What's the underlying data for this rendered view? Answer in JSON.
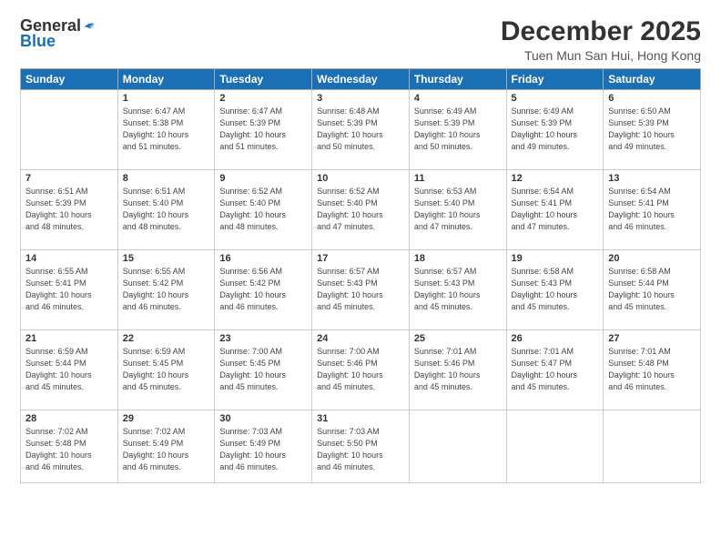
{
  "logo": {
    "general": "General",
    "blue": "Blue"
  },
  "title": "December 2025",
  "location": "Tuen Mun San Hui, Hong Kong",
  "days_header": [
    "Sunday",
    "Monday",
    "Tuesday",
    "Wednesday",
    "Thursday",
    "Friday",
    "Saturday"
  ],
  "weeks": [
    [
      {
        "day": "",
        "sunrise": "",
        "sunset": "",
        "daylight": ""
      },
      {
        "day": "1",
        "sunrise": "Sunrise: 6:47 AM",
        "sunset": "Sunset: 5:38 PM",
        "daylight": "Daylight: 10 hours and 51 minutes."
      },
      {
        "day": "2",
        "sunrise": "Sunrise: 6:47 AM",
        "sunset": "Sunset: 5:39 PM",
        "daylight": "Daylight: 10 hours and 51 minutes."
      },
      {
        "day": "3",
        "sunrise": "Sunrise: 6:48 AM",
        "sunset": "Sunset: 5:39 PM",
        "daylight": "Daylight: 10 hours and 50 minutes."
      },
      {
        "day": "4",
        "sunrise": "Sunrise: 6:49 AM",
        "sunset": "Sunset: 5:39 PM",
        "daylight": "Daylight: 10 hours and 50 minutes."
      },
      {
        "day": "5",
        "sunrise": "Sunrise: 6:49 AM",
        "sunset": "Sunset: 5:39 PM",
        "daylight": "Daylight: 10 hours and 49 minutes."
      },
      {
        "day": "6",
        "sunrise": "Sunrise: 6:50 AM",
        "sunset": "Sunset: 5:39 PM",
        "daylight": "Daylight: 10 hours and 49 minutes."
      }
    ],
    [
      {
        "day": "7",
        "sunrise": "Sunrise: 6:51 AM",
        "sunset": "Sunset: 5:39 PM",
        "daylight": "Daylight: 10 hours and 48 minutes."
      },
      {
        "day": "8",
        "sunrise": "Sunrise: 6:51 AM",
        "sunset": "Sunset: 5:40 PM",
        "daylight": "Daylight: 10 hours and 48 minutes."
      },
      {
        "day": "9",
        "sunrise": "Sunrise: 6:52 AM",
        "sunset": "Sunset: 5:40 PM",
        "daylight": "Daylight: 10 hours and 48 minutes."
      },
      {
        "day": "10",
        "sunrise": "Sunrise: 6:52 AM",
        "sunset": "Sunset: 5:40 PM",
        "daylight": "Daylight: 10 hours and 47 minutes."
      },
      {
        "day": "11",
        "sunrise": "Sunrise: 6:53 AM",
        "sunset": "Sunset: 5:40 PM",
        "daylight": "Daylight: 10 hours and 47 minutes."
      },
      {
        "day": "12",
        "sunrise": "Sunrise: 6:54 AM",
        "sunset": "Sunset: 5:41 PM",
        "daylight": "Daylight: 10 hours and 47 minutes."
      },
      {
        "day": "13",
        "sunrise": "Sunrise: 6:54 AM",
        "sunset": "Sunset: 5:41 PM",
        "daylight": "Daylight: 10 hours and 46 minutes."
      }
    ],
    [
      {
        "day": "14",
        "sunrise": "Sunrise: 6:55 AM",
        "sunset": "Sunset: 5:41 PM",
        "daylight": "Daylight: 10 hours and 46 minutes."
      },
      {
        "day": "15",
        "sunrise": "Sunrise: 6:55 AM",
        "sunset": "Sunset: 5:42 PM",
        "daylight": "Daylight: 10 hours and 46 minutes."
      },
      {
        "day": "16",
        "sunrise": "Sunrise: 6:56 AM",
        "sunset": "Sunset: 5:42 PM",
        "daylight": "Daylight: 10 hours and 46 minutes."
      },
      {
        "day": "17",
        "sunrise": "Sunrise: 6:57 AM",
        "sunset": "Sunset: 5:43 PM",
        "daylight": "Daylight: 10 hours and 45 minutes."
      },
      {
        "day": "18",
        "sunrise": "Sunrise: 6:57 AM",
        "sunset": "Sunset: 5:43 PM",
        "daylight": "Daylight: 10 hours and 45 minutes."
      },
      {
        "day": "19",
        "sunrise": "Sunrise: 6:58 AM",
        "sunset": "Sunset: 5:43 PM",
        "daylight": "Daylight: 10 hours and 45 minutes."
      },
      {
        "day": "20",
        "sunrise": "Sunrise: 6:58 AM",
        "sunset": "Sunset: 5:44 PM",
        "daylight": "Daylight: 10 hours and 45 minutes."
      }
    ],
    [
      {
        "day": "21",
        "sunrise": "Sunrise: 6:59 AM",
        "sunset": "Sunset: 5:44 PM",
        "daylight": "Daylight: 10 hours and 45 minutes."
      },
      {
        "day": "22",
        "sunrise": "Sunrise: 6:59 AM",
        "sunset": "Sunset: 5:45 PM",
        "daylight": "Daylight: 10 hours and 45 minutes."
      },
      {
        "day": "23",
        "sunrise": "Sunrise: 7:00 AM",
        "sunset": "Sunset: 5:45 PM",
        "daylight": "Daylight: 10 hours and 45 minutes."
      },
      {
        "day": "24",
        "sunrise": "Sunrise: 7:00 AM",
        "sunset": "Sunset: 5:46 PM",
        "daylight": "Daylight: 10 hours and 45 minutes."
      },
      {
        "day": "25",
        "sunrise": "Sunrise: 7:01 AM",
        "sunset": "Sunset: 5:46 PM",
        "daylight": "Daylight: 10 hours and 45 minutes."
      },
      {
        "day": "26",
        "sunrise": "Sunrise: 7:01 AM",
        "sunset": "Sunset: 5:47 PM",
        "daylight": "Daylight: 10 hours and 45 minutes."
      },
      {
        "day": "27",
        "sunrise": "Sunrise: 7:01 AM",
        "sunset": "Sunset: 5:48 PM",
        "daylight": "Daylight: 10 hours and 46 minutes."
      }
    ],
    [
      {
        "day": "28",
        "sunrise": "Sunrise: 7:02 AM",
        "sunset": "Sunset: 5:48 PM",
        "daylight": "Daylight: 10 hours and 46 minutes."
      },
      {
        "day": "29",
        "sunrise": "Sunrise: 7:02 AM",
        "sunset": "Sunset: 5:49 PM",
        "daylight": "Daylight: 10 hours and 46 minutes."
      },
      {
        "day": "30",
        "sunrise": "Sunrise: 7:03 AM",
        "sunset": "Sunset: 5:49 PM",
        "daylight": "Daylight: 10 hours and 46 minutes."
      },
      {
        "day": "31",
        "sunrise": "Sunrise: 7:03 AM",
        "sunset": "Sunset: 5:50 PM",
        "daylight": "Daylight: 10 hours and 46 minutes."
      },
      {
        "day": "",
        "sunrise": "",
        "sunset": "",
        "daylight": ""
      },
      {
        "day": "",
        "sunrise": "",
        "sunset": "",
        "daylight": ""
      },
      {
        "day": "",
        "sunrise": "",
        "sunset": "",
        "daylight": ""
      }
    ]
  ]
}
